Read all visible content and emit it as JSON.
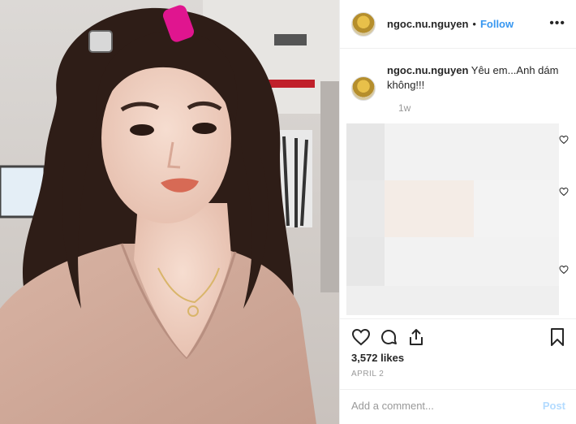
{
  "post": {
    "username": "ngoc.nu.nguyen",
    "separator": "•",
    "follow_label": "Follow",
    "more_label": "•••",
    "caption_username": "ngoc.nu.nguyen",
    "caption_text": "Yêu em...Anh dám không!!!",
    "caption_age": "1w",
    "likes": "3,572 likes",
    "date": "APRIL 2",
    "comment_placeholder": "Add a comment...",
    "post_label": "Post"
  },
  "icons": {
    "like": "heart-icon",
    "comment": "comment-icon",
    "share": "share-icon",
    "save": "bookmark-icon",
    "more": "more-options-icon",
    "comment_like": "heart-icon"
  },
  "colors": {
    "link": "#3897f0",
    "post_disabled": "#b3dbff",
    "muted": "#999999",
    "text": "#262626"
  }
}
